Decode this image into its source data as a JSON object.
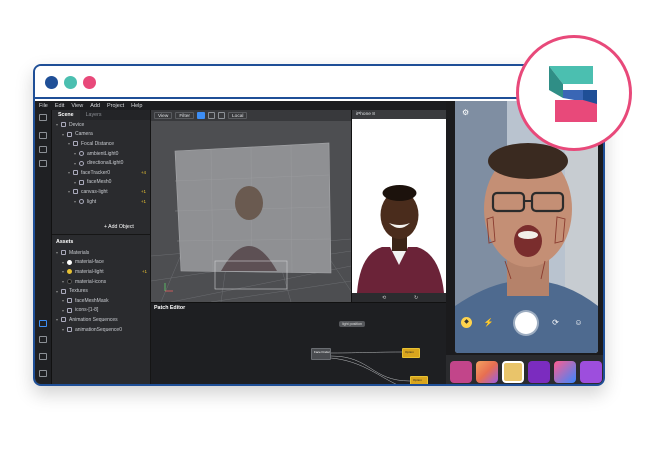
{
  "menu": [
    "File",
    "Edit",
    "View",
    "Add",
    "Project",
    "Help"
  ],
  "scene_panel": {
    "tabs": [
      "Scene",
      "Layers"
    ],
    "tree": [
      {
        "label": "Device",
        "depth": 0,
        "icon": "device-icon"
      },
      {
        "label": "Camera",
        "depth": 1,
        "icon": "camera-icon"
      },
      {
        "label": "Focal Distance",
        "depth": 2,
        "icon": "focal-icon"
      },
      {
        "label": "ambientLight0",
        "depth": 3,
        "icon": "ambient-light-icon"
      },
      {
        "label": "directionalLight0",
        "depth": 3,
        "icon": "directional-light-icon"
      },
      {
        "label": "faceTracker0",
        "depth": 2,
        "icon": "face-tracker-icon",
        "badge": "+4"
      },
      {
        "label": "faceMesh0",
        "depth": 3,
        "icon": "face-mesh-icon"
      },
      {
        "label": "canvas-light",
        "depth": 2,
        "icon": "canvas-icon",
        "badge": "+1"
      },
      {
        "label": "light",
        "depth": 3,
        "icon": "light-icon",
        "badge": "+1"
      }
    ],
    "add_object": "+ Add Object"
  },
  "assets_panel": {
    "title": "Assets",
    "tree": [
      {
        "label": "Materials",
        "depth": 0,
        "icon": "folder-icon"
      },
      {
        "label": "material-face",
        "depth": 1,
        "icon": "material-white-icon"
      },
      {
        "label": "material-light",
        "depth": 1,
        "icon": "material-yellow-icon",
        "badge": "+1"
      },
      {
        "label": "material-icons",
        "depth": 1,
        "icon": "material-black-icon"
      },
      {
        "label": "Textures",
        "depth": 0,
        "icon": "folder-icon"
      },
      {
        "label": "faceMeshMask",
        "depth": 1,
        "icon": "texture-icon"
      },
      {
        "label": "icons-[1-8]",
        "depth": 1,
        "icon": "texture-icon"
      },
      {
        "label": "Animation Sequences",
        "depth": 0,
        "icon": "folder-icon"
      },
      {
        "label": "animationSequence0",
        "depth": 1,
        "icon": "animation-icon"
      }
    ]
  },
  "viewport": {
    "view_label": "View",
    "filter_label": "Filter",
    "local_label": "Local"
  },
  "simulator": {
    "device_label": "iPhone 8"
  },
  "patch_editor": {
    "title": "Patch Editor",
    "nodes": [
      "light position",
      "Face Finder",
      "Option",
      "Option"
    ]
  },
  "colors": {
    "brand_blue": "#1f4f97",
    "brand_teal": "#4bbfb0",
    "brand_pink": "#e8497a",
    "accent": "#3d8ef5"
  }
}
